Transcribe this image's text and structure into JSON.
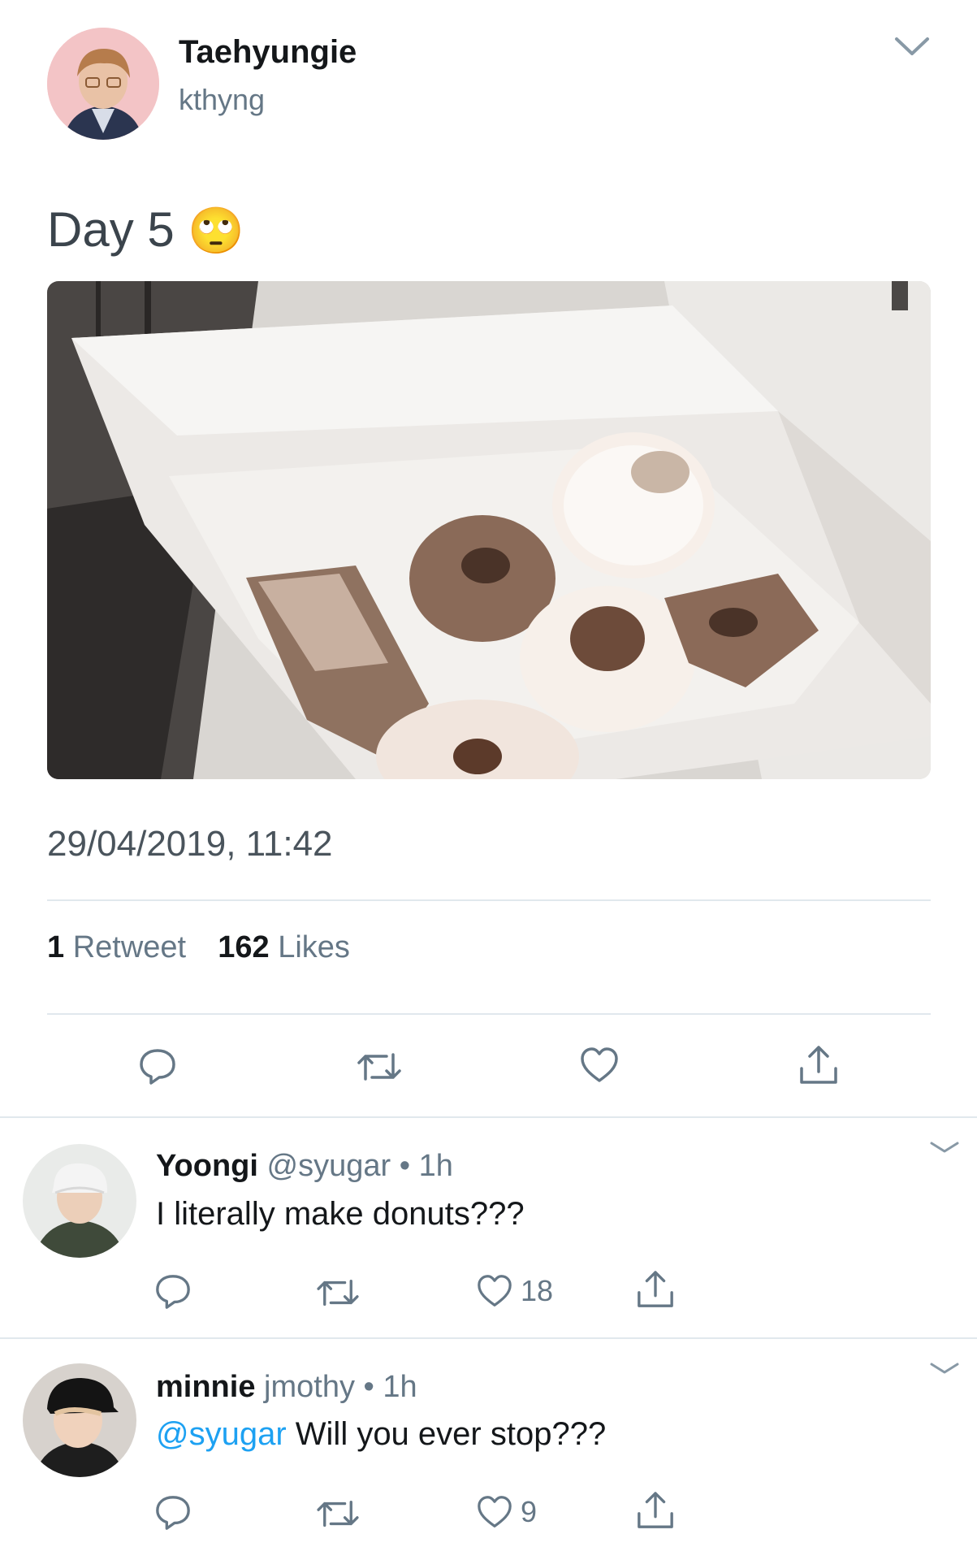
{
  "tweet": {
    "author": {
      "display_name": "Taehyungie",
      "handle": "kthyng"
    },
    "text": "Day 5",
    "emoji": "🙄",
    "timestamp": "29/04/2019, 11:42",
    "stats": {
      "retweet_count": "1",
      "retweet_label": "Retweet",
      "like_count": "162",
      "like_label": "Likes"
    }
  },
  "replies": [
    {
      "display_name": "Yoongi",
      "handle": "@syugar",
      "separator": "•",
      "time": "1h",
      "text": "I literally make donuts???",
      "like_count": "18"
    },
    {
      "display_name": "minnie",
      "handle": "jmothy",
      "separator": "•",
      "time": "1h",
      "mention": "@syugar",
      "text": " Will you ever stop???",
      "like_count": "9"
    }
  ],
  "colors": {
    "text": "#14171a",
    "muted": "#657786",
    "link": "#1da1f2",
    "divider": "#e1e8ed"
  },
  "icons": [
    "chevron-down-icon",
    "reply-icon",
    "retweet-icon",
    "like-icon",
    "share-icon"
  ]
}
